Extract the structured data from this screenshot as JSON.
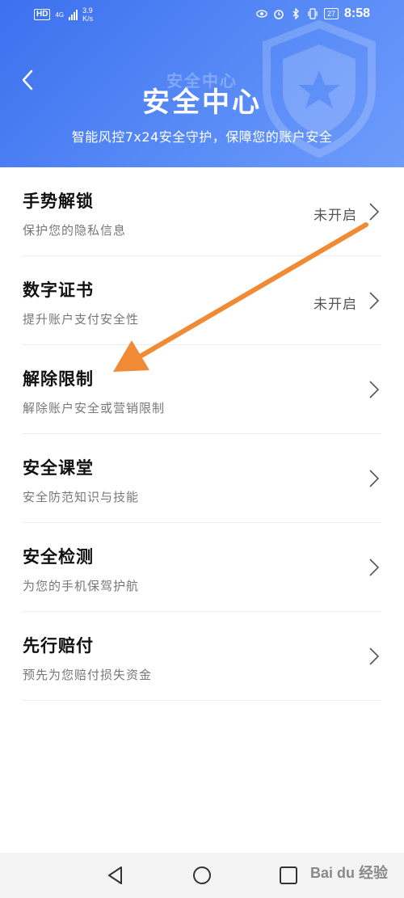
{
  "status_bar": {
    "hd": "HD",
    "network": "4G",
    "speed_value": "3.9",
    "speed_unit": "K/s",
    "battery": "27",
    "time": "8:58"
  },
  "header": {
    "ghost_title": "安全中心",
    "title": "安全中心",
    "subtitle": "智能风控7x24安全守护，保障您的账户安全"
  },
  "items": [
    {
      "title": "手势解锁",
      "desc": "保护您的隐私信息",
      "status": "未开启"
    },
    {
      "title": "数字证书",
      "desc": "提升账户支付安全性",
      "status": "未开启"
    },
    {
      "title": "解除限制",
      "desc": "解除账户安全或营销限制",
      "status": ""
    },
    {
      "title": "安全课堂",
      "desc": "安全防范知识与技能",
      "status": ""
    },
    {
      "title": "安全检测",
      "desc": "为您的手机保驾护航",
      "status": ""
    },
    {
      "title": "先行赔付",
      "desc": "预先为您赔付损失资金",
      "status": ""
    }
  ],
  "watermark": "Bai du 经验",
  "colors": {
    "header_start": "#3c70ee",
    "header_end": "#6e9cfb",
    "arrow": "#f08a35"
  },
  "icons": [
    "back-arrow-icon",
    "chevron-right-icon",
    "nav-back-icon",
    "nav-home-icon",
    "nav-recents-icon",
    "shield-icon"
  ]
}
